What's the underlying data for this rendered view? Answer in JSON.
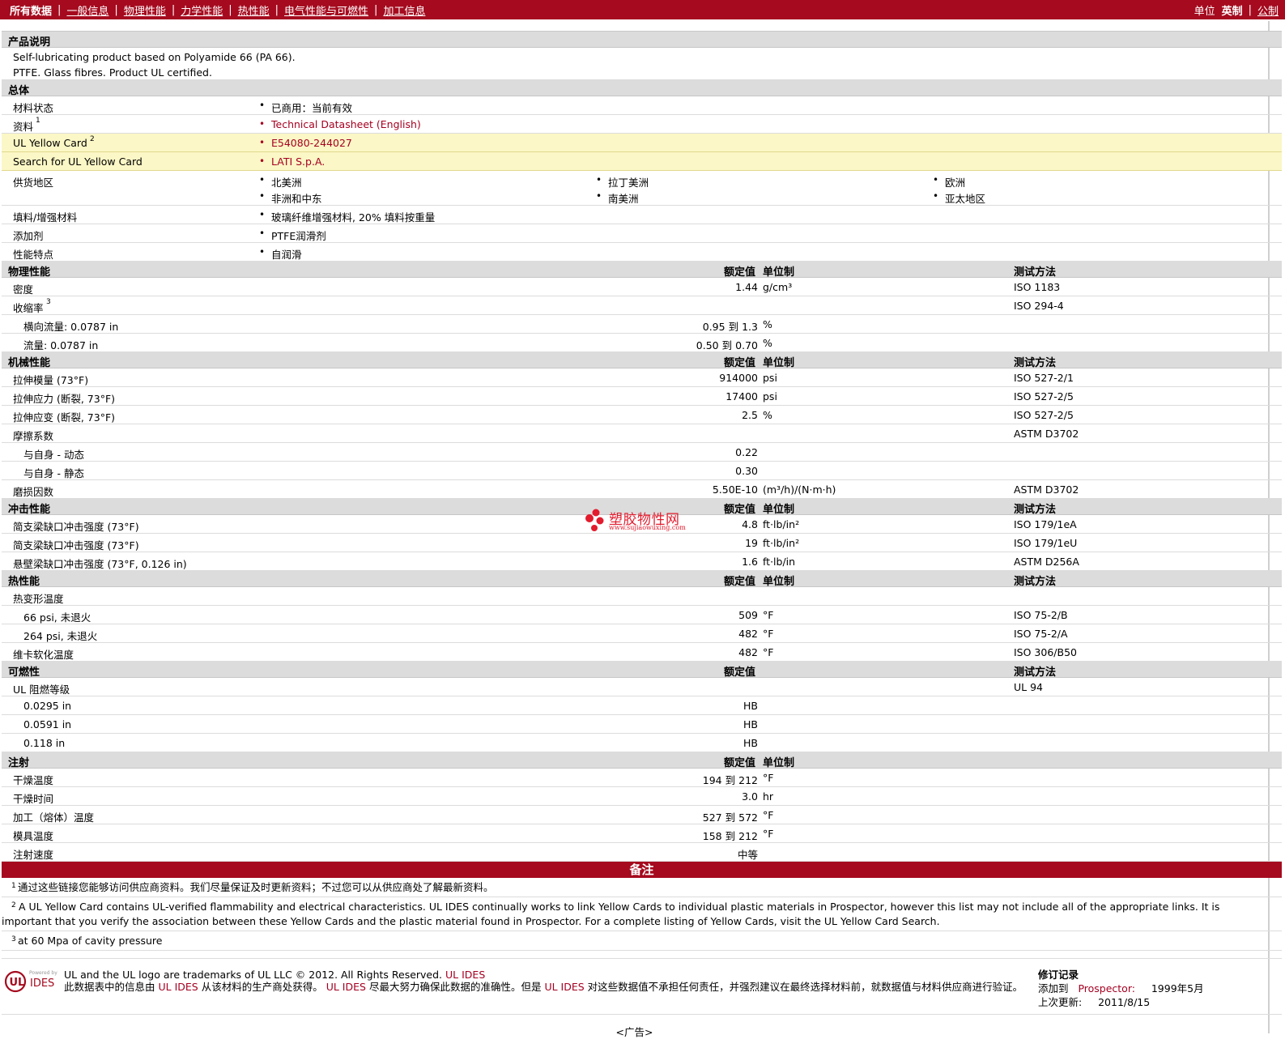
{
  "nav": {
    "items": [
      "所有数据",
      "一般信息",
      "物理性能",
      "力学性能",
      "热性能",
      "电气性能与可燃性",
      "加工信息"
    ],
    "unit_label": "单位",
    "unit_options": [
      "英制",
      "公制"
    ]
  },
  "product": {
    "header": "产品说明",
    "line1": "Self-lubricating product based on Polyamide 66 (PA 66).",
    "line2": "PTFE. Glass fibres. Product UL certified."
  },
  "general": {
    "header": "总体",
    "rows": [
      {
        "label": "材料状态",
        "sup": "",
        "values": [
          "已商用：当前有效"
        ]
      },
      {
        "label": "资料",
        "sup": "1",
        "values": [
          "Technical Datasheet (English)"
        ]
      },
      {
        "label": "UL Yellow Card",
        "sup": "2",
        "values": [
          "E54080-244027"
        ]
      },
      {
        "label": "Search for UL Yellow Card",
        "sup": "",
        "values": [
          "LATI S.p.A."
        ]
      },
      {
        "label": "供货地区",
        "sup": "",
        "values": [
          "北美洲",
          "拉丁美洲",
          "欧洲",
          "非洲和中东",
          "南美洲",
          "亚太地区"
        ]
      },
      {
        "label": "填料/增强材料",
        "sup": "",
        "values": [
          "玻璃纤维增强材料, 20% 填料按重量"
        ]
      },
      {
        "label": "添加剂",
        "sup": "",
        "values": [
          "PTFE润滑剂"
        ]
      },
      {
        "label": "性能特点",
        "sup": "",
        "values": [
          "自润滑"
        ]
      }
    ]
  },
  "col_headers": {
    "nominal": "额定值",
    "unit": "单位制",
    "method": "测试方法"
  },
  "to_word": "到",
  "sections": [
    {
      "header": "物理性能",
      "show_unit": true,
      "show_method": true,
      "rows": [
        {
          "label": "密度",
          "sub": false,
          "v1": "1.44",
          "v2": "",
          "unit": "g/cm³",
          "method": "ISO 1183"
        },
        {
          "label": "收缩率",
          "sup": "3",
          "sub": false,
          "v1": "",
          "v2": "",
          "unit": "",
          "method": "ISO 294-4"
        },
        {
          "label": "横向流量: 0.0787 in",
          "sub": true,
          "v1": "0.95",
          "v2": "1.3",
          "unit": "%",
          "method": ""
        },
        {
          "label": "流量: 0.0787 in",
          "sub": true,
          "v1": "0.50",
          "v2": "0.70",
          "unit": "%",
          "method": ""
        }
      ]
    },
    {
      "header": "机械性能",
      "show_unit": true,
      "show_method": true,
      "rows": [
        {
          "label": "拉伸模量 (73°F)",
          "sub": false,
          "v1": "914000",
          "v2": "",
          "unit": "psi",
          "method": "ISO 527-2/1"
        },
        {
          "label": "拉伸应力 (断裂, 73°F)",
          "sub": false,
          "v1": "17400",
          "v2": "",
          "unit": "psi",
          "method": "ISO 527-2/5"
        },
        {
          "label": "拉伸应变 (断裂, 73°F)",
          "sub": false,
          "v1": "2.5",
          "v2": "",
          "unit": "%",
          "method": "ISO 527-2/5"
        },
        {
          "label": "摩擦系数",
          "sub": false,
          "v1": "",
          "v2": "",
          "unit": "",
          "method": "ASTM D3702"
        },
        {
          "label": "与自身 - 动态",
          "sub": true,
          "v1": "0.22",
          "v2": "",
          "unit": "",
          "method": ""
        },
        {
          "label": "与自身 - 静态",
          "sub": true,
          "v1": "0.30",
          "v2": "",
          "unit": "",
          "method": ""
        },
        {
          "label": "磨损因数",
          "sub": false,
          "v1": "5.50E-10",
          "v2": "",
          "unit": "(m³/h)/(N·m·h)",
          "method": "ASTM D3702"
        }
      ]
    },
    {
      "header": "冲击性能",
      "show_unit": true,
      "show_method": true,
      "rows": [
        {
          "label": "简支梁缺口冲击强度 (73°F)",
          "sub": false,
          "v1": "4.8",
          "v2": "",
          "unit": "ft·lb/in²",
          "method": "ISO 179/1eA"
        },
        {
          "label": "简支梁缺口冲击强度 (73°F)",
          "sub": false,
          "v1": "19",
          "v2": "",
          "unit": "ft·lb/in²",
          "method": "ISO 179/1eU"
        },
        {
          "label": "悬壁梁缺口冲击强度 (73°F, 0.126 in)",
          "sub": false,
          "v1": "1.6",
          "v2": "",
          "unit": "ft·lb/in",
          "method": "ASTM D256A"
        }
      ]
    },
    {
      "header": "热性能",
      "show_unit": true,
      "show_method": true,
      "rows": [
        {
          "label": "热变形温度",
          "sub": false,
          "v1": "",
          "v2": "",
          "unit": "",
          "method": ""
        },
        {
          "label": "66 psi, 未退火",
          "sub": true,
          "v1": "509",
          "v2": "",
          "unit": "°F",
          "method": "ISO 75-2/B"
        },
        {
          "label": "264 psi, 未退火",
          "sub": true,
          "v1": "482",
          "v2": "",
          "unit": "°F",
          "method": "ISO 75-2/A"
        },
        {
          "label": "维卡软化温度",
          "sub": false,
          "v1": "482",
          "v2": "",
          "unit": "°F",
          "method": "ISO 306/B50"
        }
      ]
    },
    {
      "header": "可燃性",
      "show_unit": false,
      "show_method": true,
      "rows": [
        {
          "label": "UL 阻燃等级",
          "sub": false,
          "v1": "",
          "v2": "",
          "unit": "",
          "method": "UL 94"
        },
        {
          "label": "0.0295 in",
          "sub": true,
          "v1": "HB",
          "v2": "",
          "unit": "",
          "method": ""
        },
        {
          "label": "0.0591 in",
          "sub": true,
          "v1": "HB",
          "v2": "",
          "unit": "",
          "method": ""
        },
        {
          "label": "0.118 in",
          "sub": true,
          "v1": "HB",
          "v2": "",
          "unit": "",
          "method": ""
        }
      ]
    },
    {
      "header": "注射",
      "show_unit": true,
      "show_method": false,
      "rows": [
        {
          "label": "干燥温度",
          "sub": false,
          "v1": "194",
          "v2": "212",
          "unit": "°F",
          "method": ""
        },
        {
          "label": "干燥时间",
          "sub": false,
          "v1": "3.0",
          "v2": "",
          "unit": "hr",
          "method": ""
        },
        {
          "label": "加工（熔体）温度",
          "sub": false,
          "v1": "527",
          "v2": "572",
          "unit": "°F",
          "method": ""
        },
        {
          "label": "模具温度",
          "sub": false,
          "v1": "158",
          "v2": "212",
          "unit": "°F",
          "method": ""
        },
        {
          "label": "注射速度",
          "sub": false,
          "v1": "中等",
          "v2": "",
          "unit": "",
          "method": ""
        }
      ]
    }
  ],
  "notes": {
    "header": "备注",
    "items": [
      {
        "num": "1",
        "text": "通过这些链接您能够访问供应商资料。我们尽量保证及时更新资料；不过您可以从供应商处了解最新资料。"
      },
      {
        "num": "2",
        "text": "A UL Yellow Card contains UL-verified flammability and electrical characteristics. UL IDES continually works to link Yellow Cards to individual plastic materials in Prospector, however this list may not include all of the appropriate links. It is important that you verify the association between these Yellow Cards and the plastic material found in Prospector. For a complete listing of Yellow Cards, visit the UL Yellow Card Search."
      },
      {
        "num": "3",
        "text": "at 60 Mpa of cavity pressure"
      }
    ]
  },
  "watermark": {
    "title": "塑胶物性网",
    "url": "www.sujiaowuxing.com"
  },
  "footer": {
    "logo_powered": "Powered by",
    "logo_ul": "UL",
    "logo_ides": "IDES",
    "trademark": "UL and the UL logo are trademarks of UL LLC © 2012. All Rights Reserved.",
    "trademark_link": "UL IDES",
    "disclaimer_a": "此数据表中的信息由",
    "disclaimer_link1": "UL IDES",
    "disclaimer_b": "从该材料的生产商处获得。",
    "disclaimer_link2": "UL IDES",
    "disclaimer_c": "尽最大努力确保此数据的准确性。但是",
    "disclaimer_link3": "UL IDES",
    "disclaimer_d": "对这些数据值不承担任何责任，并强烈建议在最终选择材料前，就数据值与材料供应商进行验证。",
    "rev_header": "修订记录",
    "added_label": "添加到",
    "added_link": "Prospector:",
    "added_date": "1999年5月",
    "updated_label": "上次更新:",
    "updated_date": "2011/8/15"
  },
  "ad": "<广告>"
}
